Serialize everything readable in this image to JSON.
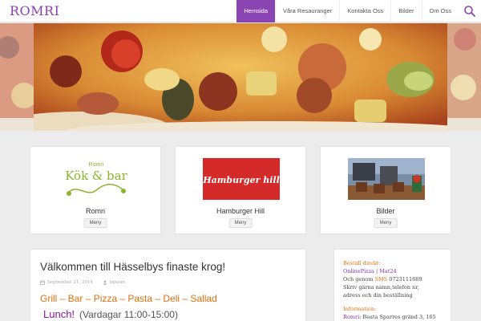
{
  "header": {
    "logo": "ROMRI",
    "nav": [
      {
        "label": "Hemsida",
        "active": true
      },
      {
        "label": "Våra Resauranger",
        "active": false
      },
      {
        "label": "Kontakta Oss",
        "active": false
      },
      {
        "label": "Bilder",
        "active": false
      },
      {
        "label": "Om Oss",
        "active": false
      }
    ],
    "search_icon": "search-icon"
  },
  "cards": [
    {
      "title": "Romri",
      "menu": "Meny",
      "logo_line1": "Romri",
      "logo_line2": "Kök & bar"
    },
    {
      "title": "Hamburger Hill",
      "menu": "Meny",
      "logo_text": "Hamburger hill"
    },
    {
      "title": "Bilder",
      "menu": "Meny"
    }
  ],
  "article": {
    "title": "Välkommen till Hässelbys finaste krog!",
    "date": "September 21, 2014",
    "author": "bguom",
    "tagline": "Grill – Bar – Pizza – Pasta – Deli – Sallad",
    "lunch": "Lunch!",
    "hours": "(Vardagar 11:00-15:00)"
  },
  "sidebar": {
    "order_heading": "Beställ direkt:",
    "order_links": "OnlinePizza | Mat24",
    "sms_prefix": "Och genom",
    "sms_label": "SMS",
    "sms_number": "0723111689",
    "sms_line2": "Skriv gärna namn,telefon nr,",
    "sms_line3": "adress och din beställning",
    "info_heading": "Information:",
    "info_name": "Romri",
    "info_address": ": Beata Sparres gränd 3, 165"
  },
  "colors": {
    "accent": "#8b45b3",
    "orange": "#e0700e",
    "lunch": "#8b1a9a"
  }
}
